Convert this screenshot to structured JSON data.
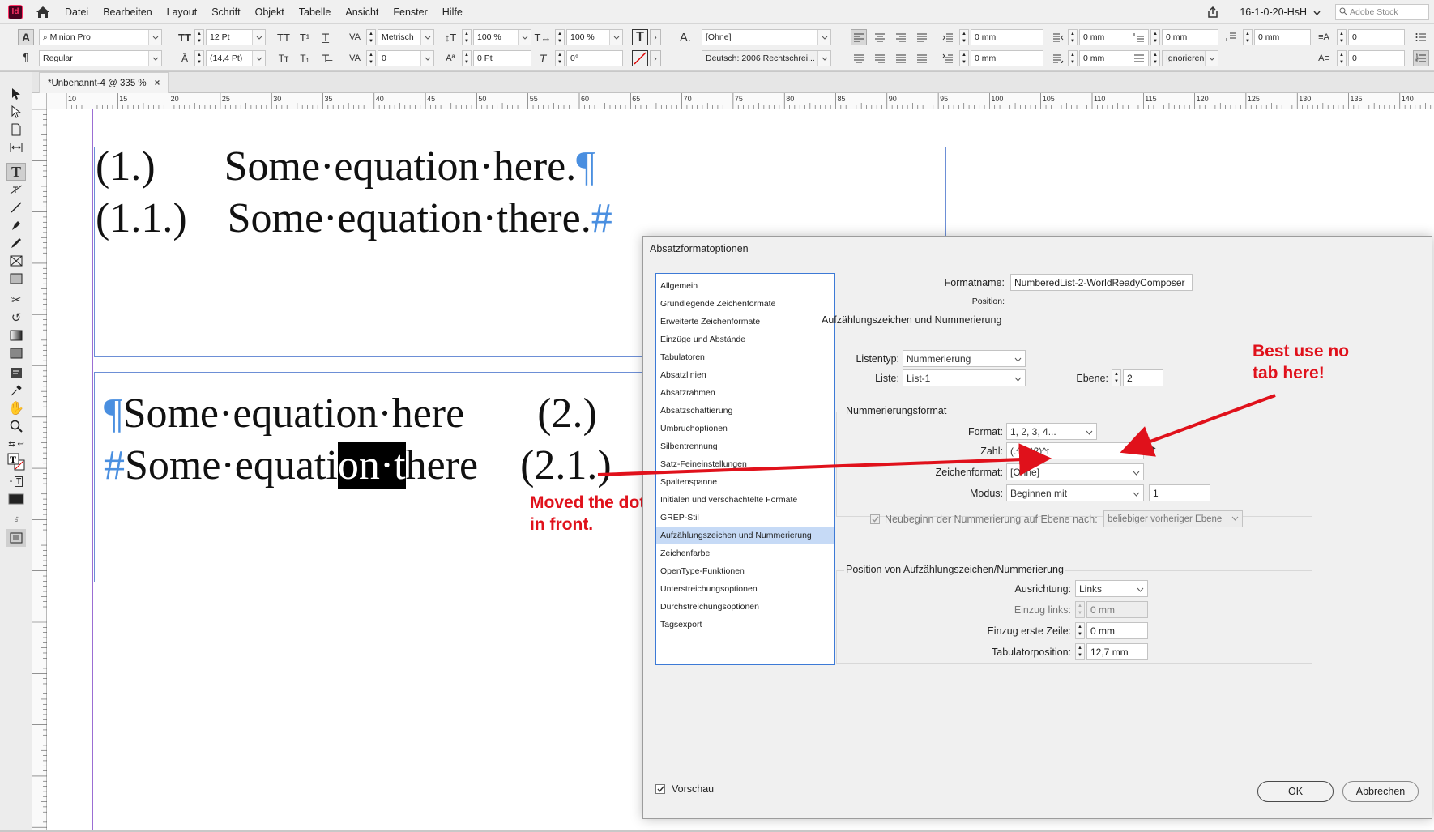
{
  "menubar": {
    "app_icon": "Id",
    "items": [
      "Datei",
      "Bearbeiten",
      "Layout",
      "Schrift",
      "Objekt",
      "Tabelle",
      "Ansicht",
      "Fenster",
      "Hilfe"
    ],
    "workspace": "16-1-0-20-HsH",
    "search_placeholder": "Adobe Stock"
  },
  "control": {
    "font_family": "Minion Pro",
    "font_style": "Regular",
    "font_size": "12 Pt",
    "leading": "(14,4 Pt)",
    "kerning": "Metrisch",
    "tracking": "0",
    "vscale": "100 %",
    "hscale": "100 %",
    "baseline": "0 Pt",
    "skew": "0°",
    "char_style": "[Ohne]",
    "language": "Deutsch: 2006 Rechtschrei...",
    "indent_left": "0 mm",
    "indent_right": "0 mm",
    "indent_first": "0 mm",
    "indent_last": "0 mm",
    "space_before": "0 mm",
    "space_after": "0 mm",
    "dropcap_lines": "0",
    "dropcap_chars": "0",
    "grid_align": "Ignorieren"
  },
  "doc_tab": {
    "title": "*Unbenannt-4 @ 335 %"
  },
  "ruler": {
    "labels": [
      "10",
      "15",
      "20",
      "25",
      "30",
      "35",
      "40",
      "45",
      "50",
      "55",
      "60",
      "65",
      "70",
      "75",
      "80",
      "85",
      "90",
      "95",
      "100",
      "105",
      "110",
      "115",
      "120",
      "125",
      "130",
      "135",
      "140"
    ]
  },
  "document": {
    "line1_num": "(1.)",
    "line1_text": "Some·equation·here.",
    "line2_num": "(1.1.)",
    "line2_text": "Some·equation·there.",
    "line3_text": "Some·equation·here",
    "line3_num": "(2.)",
    "line4_pre": "Some·equati",
    "line4_sel": "on·t",
    "line4_post": "here",
    "line4_num": "(2.1.)",
    "pilcrow": "¶",
    "hash": "#"
  },
  "annotations": {
    "moved_line1": "Moved the dot",
    "moved_line2": "in front.",
    "tab_line1": "Best use no",
    "tab_line2": "tab here!"
  },
  "dialog": {
    "title": "Absatzformatoptionen",
    "categories": [
      "Allgemein",
      "Grundlegende Zeichenformate",
      "Erweiterte Zeichenformate",
      "Einzüge und Abstände",
      "Tabulatoren",
      "Absatzlinien",
      "Absatzrahmen",
      "Absatzschattierung",
      "Umbruchoptionen",
      "Silbentrennung",
      "Satz-Feineinstellungen",
      "Spaltenspanne",
      "Initialen und verschachtelte Formate",
      "GREP-Stil",
      "Aufzählungszeichen und Nummerierung",
      "Zeichenfarbe",
      "OpenType-Funktionen",
      "Unterstreichungsoptionen",
      "Durchstreichungsoptionen",
      "Tagsexport"
    ],
    "active_category": "Aufzählungszeichen und Nummerierung",
    "formatname_label": "Formatname:",
    "formatname_value": "NumberedList-2-WorldReadyComposer",
    "position_label": "Position:",
    "section_title": "Aufzählungszeichen und Nummerierung",
    "listentyp_label": "Listentyp:",
    "listentyp_value": "Nummerierung",
    "liste_label": "Liste:",
    "liste_value": "List-1",
    "ebene_label": "Ebene:",
    "ebene_value": "2",
    "numformat_title": "Nummerierungsformat",
    "format_label": "Format:",
    "format_value": "1, 2, 3, 4...",
    "zahl_label": "Zahl:",
    "zahl_value": "(.^1.^2)^t",
    "zeichenformat_label": "Zeichenformat:",
    "zeichenformat_value": "[Ohne]",
    "modus_label": "Modus:",
    "modus_value": "Beginnen mit",
    "modus_start": "1",
    "neubeginn_label": "Neubeginn der Nummerierung auf Ebene nach:",
    "neubeginn_value": "beliebiger vorheriger Ebene",
    "position_title": "Position von Aufzählungszeichen/Nummerierung",
    "ausrichtung_label": "Ausrichtung:",
    "ausrichtung_value": "Links",
    "einzug_links_label": "Einzug links:",
    "einzug_links_value": "0 mm",
    "einzug_erste_label": "Einzug erste Zeile:",
    "einzug_erste_value": "0 mm",
    "tabpos_label": "Tabulatorposition:",
    "tabpos_value": "12,7 mm",
    "vorschau_label": "Vorschau",
    "ok_label": "OK",
    "cancel_label": "Abbrechen"
  }
}
